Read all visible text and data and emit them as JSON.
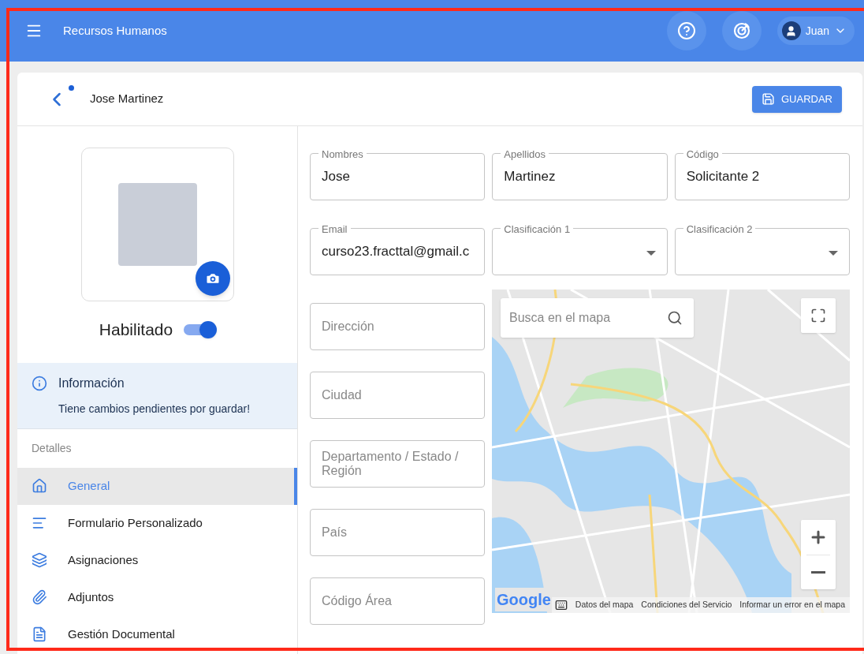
{
  "app_bar": {
    "title": "Recursos Humanos",
    "user": "Juan"
  },
  "header": {
    "title": "Jose Martinez",
    "unsaved": true,
    "save_button": "GUARDAR"
  },
  "profile": {
    "status_label": "Habilitado",
    "enabled": true
  },
  "info": {
    "title": "Información",
    "message": "Tiene cambios pendientes por guardar!"
  },
  "nav": {
    "section": "Detalles",
    "items": [
      {
        "label": "General",
        "selected": true
      },
      {
        "label": "Formulario Personalizado",
        "selected": false
      },
      {
        "label": "Asignaciones",
        "selected": false
      },
      {
        "label": "Adjuntos",
        "selected": false
      },
      {
        "label": "Gestión Documental",
        "selected": false
      }
    ]
  },
  "form_fields": [
    {
      "label": "Nombres",
      "value": "Jose",
      "kind": "text"
    },
    {
      "label": "Apellidos",
      "value": "Martinez",
      "kind": "text"
    },
    {
      "label": "Código",
      "value": "Solicitante 2",
      "kind": "text"
    },
    {
      "label": "Email",
      "value": "curso23.fracttal@gmail.c",
      "kind": "text"
    },
    {
      "label": "Clasificación 1",
      "kind": "select"
    },
    {
      "label": "Clasificación 2",
      "kind": "select"
    }
  ],
  "address_fields": [
    {
      "placeholder": "Dirección"
    },
    {
      "placeholder": "Ciudad"
    },
    {
      "placeholder": "Departamento / Estado / Región"
    },
    {
      "placeholder": "País"
    },
    {
      "placeholder": "Código Área"
    }
  ],
  "map": {
    "search_placeholder": "Busca en el mapa",
    "logo": "Google",
    "attribution": [
      "Datos del mapa",
      "Condiciones del Servicio",
      "Informar un error en el mapa"
    ]
  }
}
